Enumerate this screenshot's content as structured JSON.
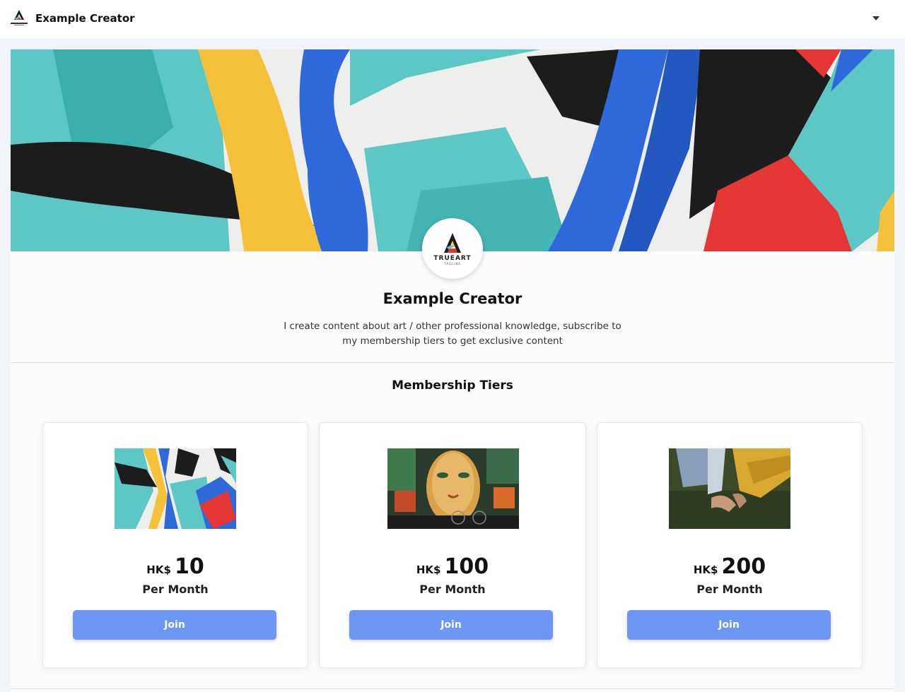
{
  "header": {
    "brand_name": "Example Creator",
    "menu_icon": "chevron-down-icon"
  },
  "profile": {
    "name": "Example Creator",
    "description": "I create content about art / other professional knowledge, subscribe to my membership tiers to get exclusive content",
    "avatar_brand": "TRUEART",
    "avatar_tagline": "TAGLINE"
  },
  "tiers": {
    "heading": "Membership Tiers",
    "items": [
      {
        "currency": "HK$",
        "amount": "10",
        "period": "Per Month",
        "button": "Join"
      },
      {
        "currency": "HK$",
        "amount": "100",
        "period": "Per Month",
        "button": "Join"
      },
      {
        "currency": "HK$",
        "amount": "200",
        "period": "Per Month",
        "button": "Join"
      }
    ]
  },
  "colors": {
    "accent": "#6e97f3",
    "teal": "#5cc7c4",
    "yellow": "#f6c13a",
    "blue": "#2f68d8",
    "red": "#e53636",
    "black": "#1c1c1c"
  }
}
